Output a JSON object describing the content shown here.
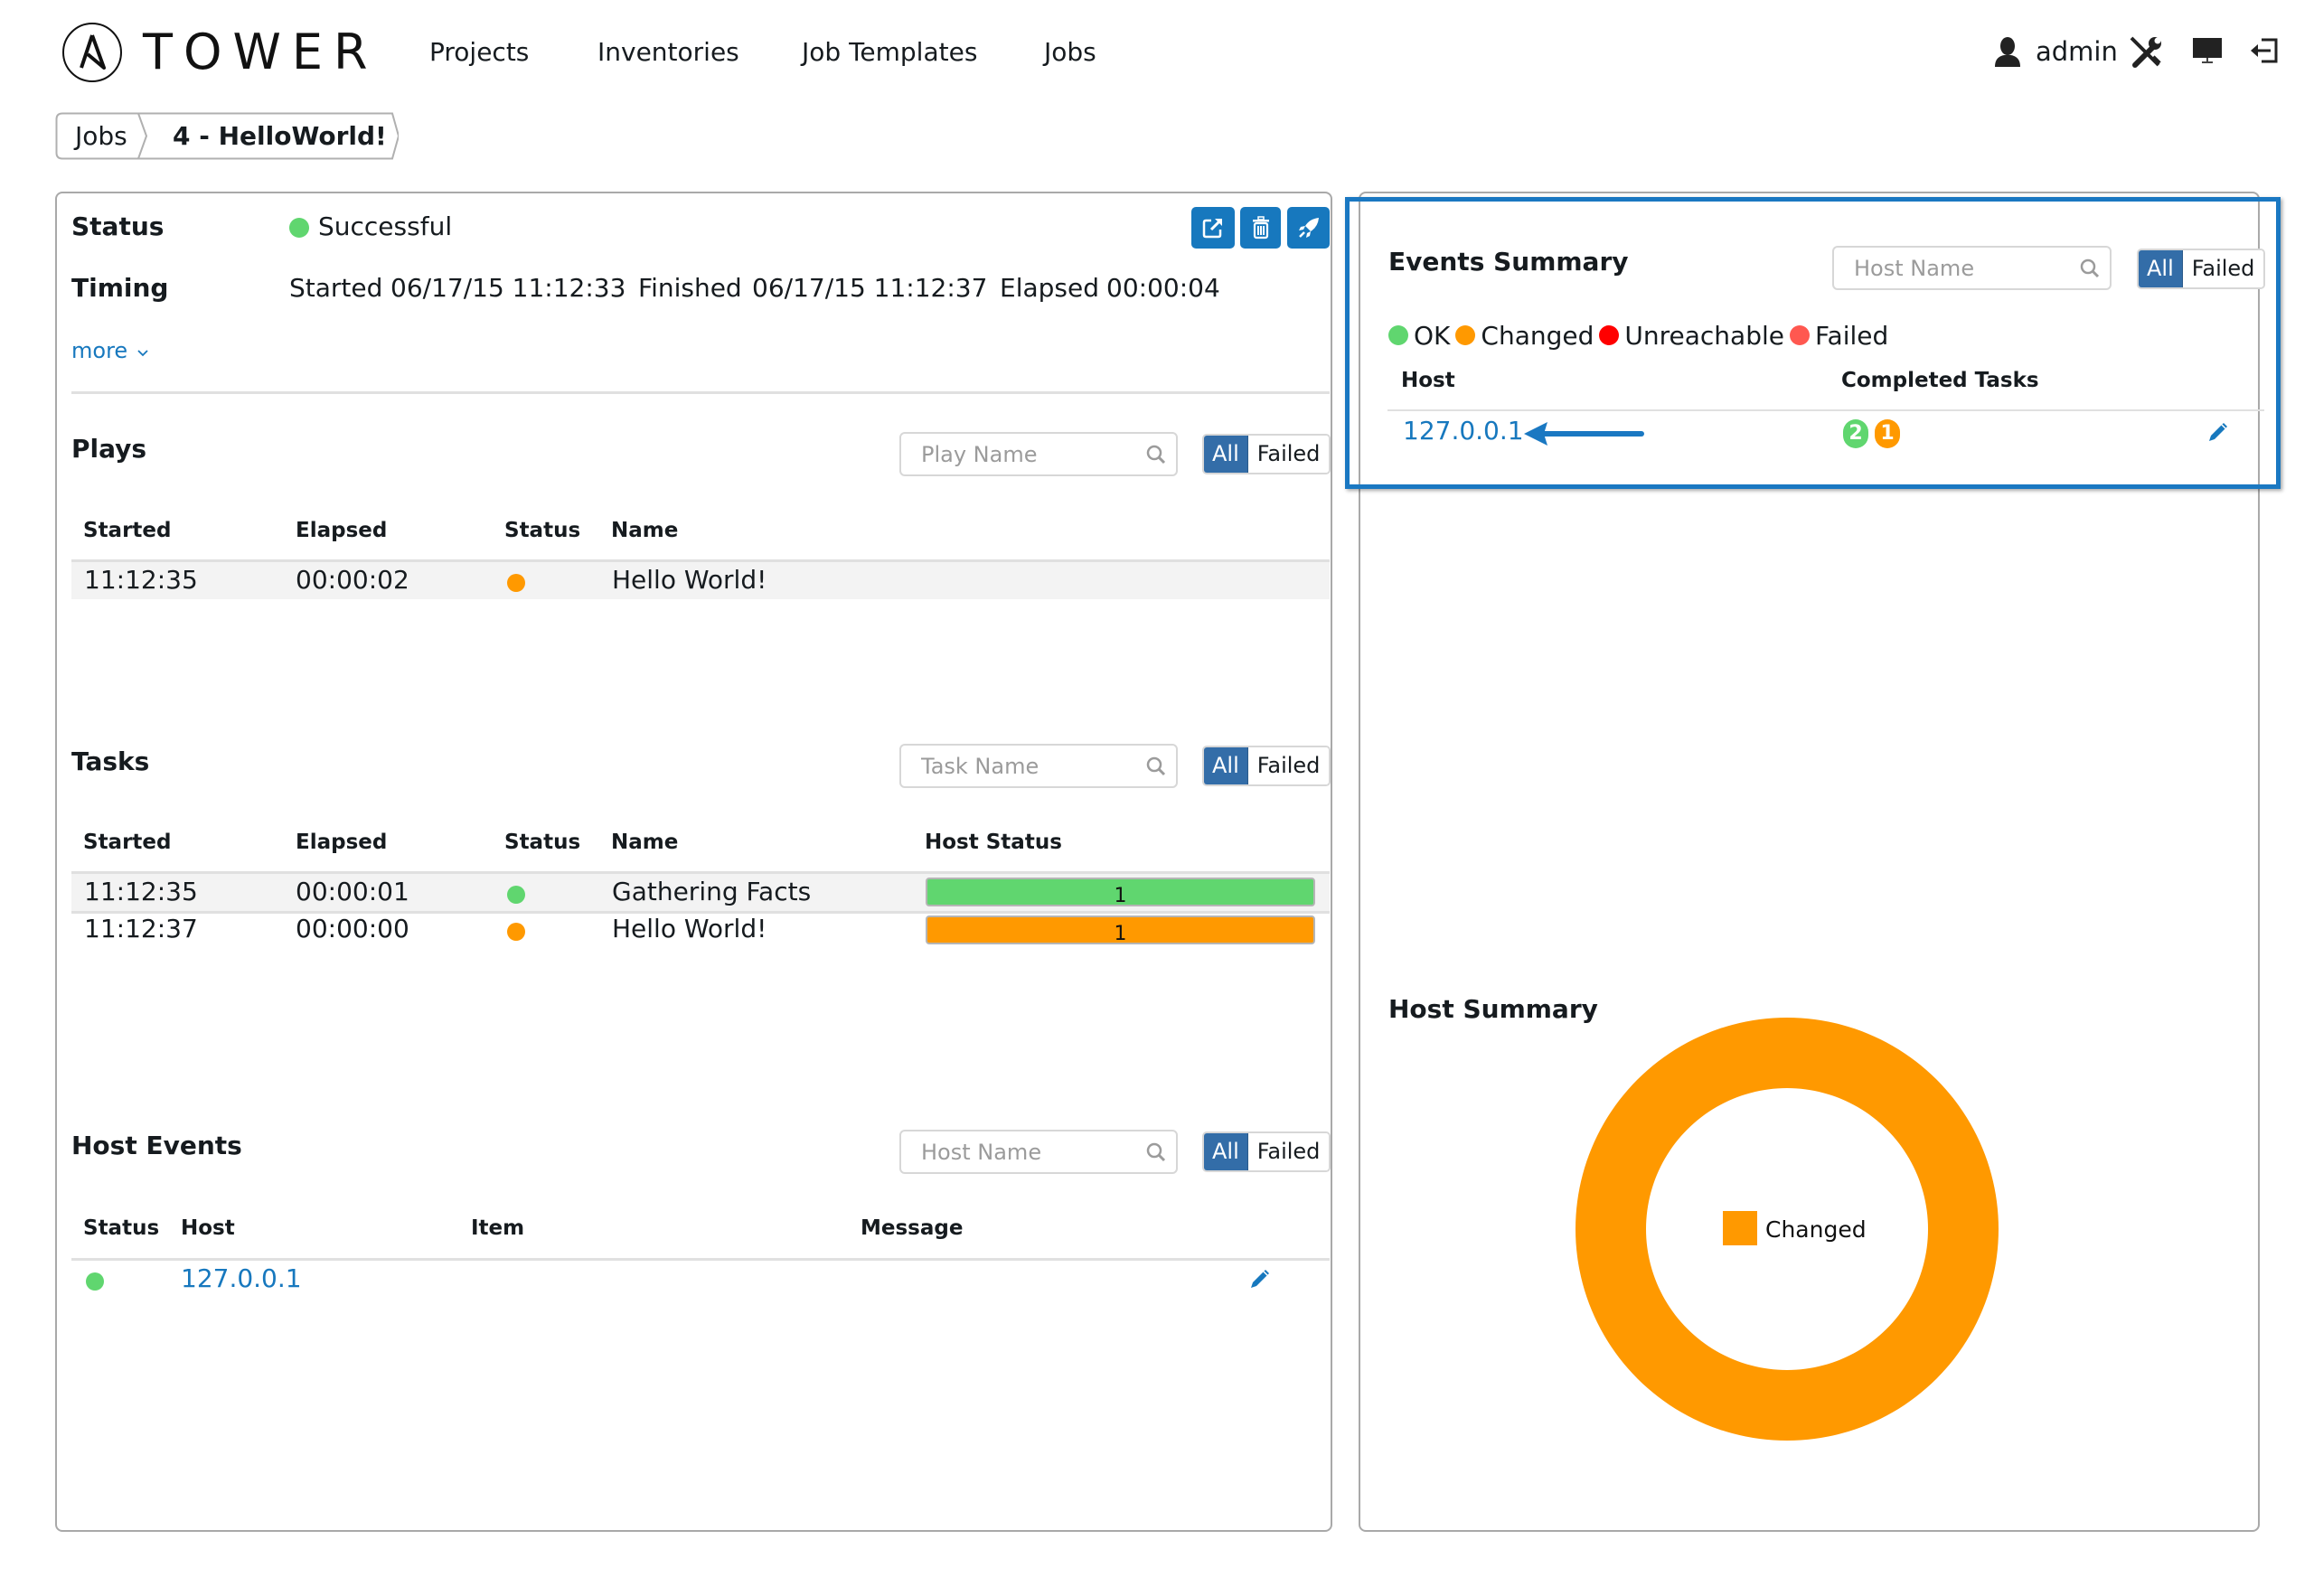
{
  "app": {
    "logo_text": "TOWER",
    "nav": [
      {
        "label": "Projects"
      },
      {
        "label": "Inventories"
      },
      {
        "label": "Job Templates"
      },
      {
        "label": "Jobs"
      }
    ],
    "user": {
      "name": "admin",
      "icon": "user-icon"
    },
    "top_icons": [
      "user-icon",
      "tools-icon",
      "monitor-icon",
      "logout-icon"
    ]
  },
  "breadcrumb": [
    {
      "label": "Jobs"
    },
    {
      "label": "4 - HelloWorld!"
    }
  ],
  "job": {
    "status_label": "Status",
    "status_value": "Successful",
    "status_color": "#60d66f",
    "timing_label": "Timing",
    "started_label": "Started",
    "started_value": "06/17/15 11:12:33",
    "finished_label": "Finished",
    "finished_value": "06/17/15 11:12:37",
    "elapsed_label": "Elapsed",
    "elapsed_value": "00:00:04",
    "more_label": "more",
    "actions": [
      "external-link-icon",
      "delete-icon",
      "relaunch-rocket-icon"
    ]
  },
  "plays": {
    "title": "Plays",
    "search_placeholder": "Play Name",
    "filter_all": "All",
    "filter_failed": "Failed",
    "columns": [
      "Started",
      "Elapsed",
      "Status",
      "Name"
    ],
    "rows": [
      {
        "started": "11:12:35",
        "elapsed": "00:00:02",
        "status": "changed",
        "name": "Hello World!"
      }
    ]
  },
  "tasks": {
    "title": "Tasks",
    "search_placeholder": "Task Name",
    "filter_all": "All",
    "filter_failed": "Failed",
    "columns": [
      "Started",
      "Elapsed",
      "Status",
      "Name",
      "Host Status"
    ],
    "rows": [
      {
        "started": "11:12:35",
        "elapsed": "00:00:01",
        "status": "ok",
        "name": "Gathering Facts",
        "host_status_count": "1",
        "host_status": "ok"
      },
      {
        "started": "11:12:37",
        "elapsed": "00:00:00",
        "status": "changed",
        "name": "Hello World!",
        "host_status_count": "1",
        "host_status": "changed"
      }
    ]
  },
  "host_events": {
    "title": "Host Events",
    "search_placeholder": "Host Name",
    "filter_all": "All",
    "filter_failed": "Failed",
    "columns": [
      "Status",
      "Host",
      "Item",
      "Message"
    ],
    "rows": [
      {
        "status": "ok",
        "host": "127.0.0.1",
        "item": "",
        "message": ""
      }
    ]
  },
  "events_summary": {
    "title": "Events Summary",
    "search_placeholder": "Host Name",
    "filter_all": "All",
    "filter_failed": "Failed",
    "legend": [
      {
        "label": "OK",
        "color": "#60d66f"
      },
      {
        "label": "Changed",
        "color": "#ff9900"
      },
      {
        "label": "Unreachable",
        "color": "#ff0000"
      },
      {
        "label": "Failed",
        "color": "#ff5850"
      }
    ],
    "columns": [
      "Host",
      "Completed Tasks"
    ],
    "rows": [
      {
        "host": "127.0.0.1",
        "ok_count": "2",
        "changed_count": "1"
      }
    ]
  },
  "host_summary": {
    "title": "Host Summary"
  },
  "colors": {
    "ok": "#60d66f",
    "changed": "#ff9900",
    "unreachable": "#ff0000",
    "failed": "#ff5850",
    "accent": "#1778be",
    "toggle_active": "#336da8"
  },
  "chart_data": {
    "type": "pie",
    "title": "Host Summary",
    "donut": true,
    "categories": [
      "Changed"
    ],
    "values": [
      1
    ],
    "colors": [
      "#ff9900"
    ],
    "legend": [
      "Changed"
    ],
    "legend_position": "center"
  }
}
